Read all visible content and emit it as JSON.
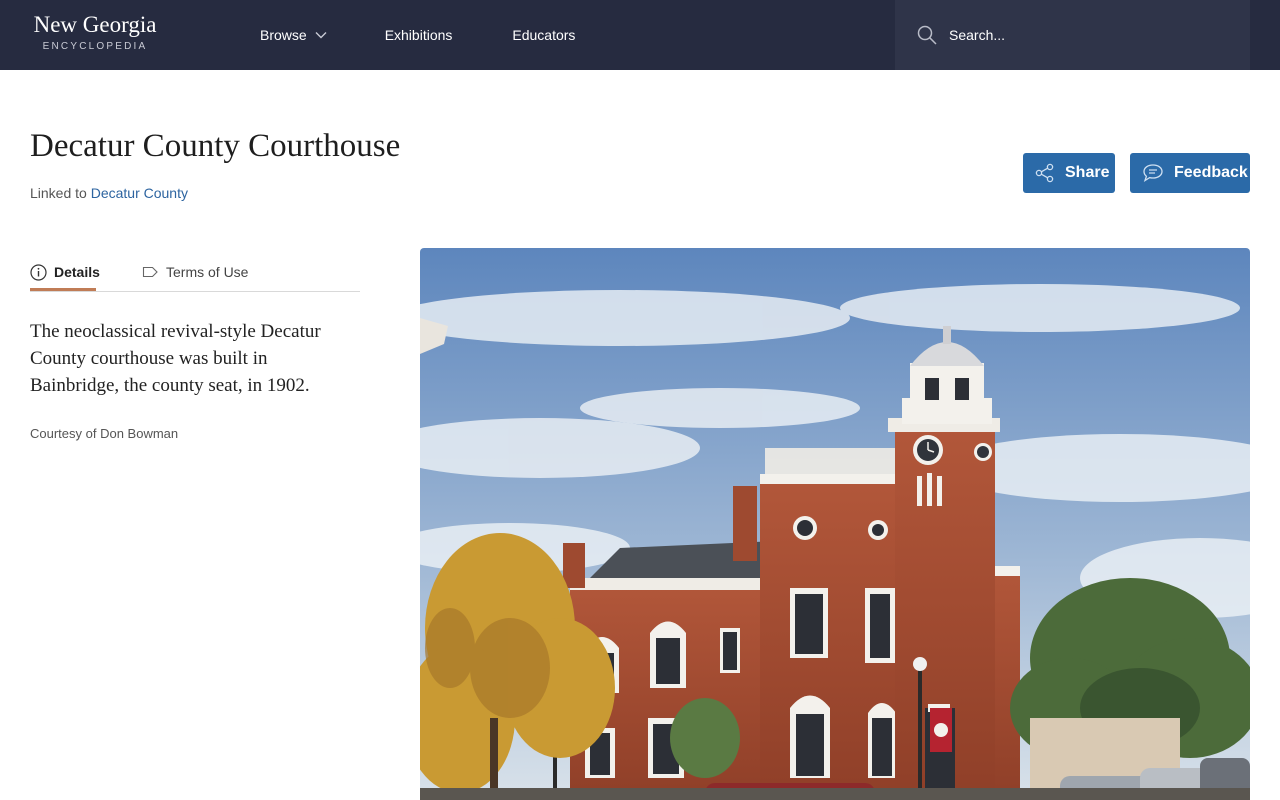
{
  "header": {
    "logo_main": "New Georgia",
    "logo_sub": "ENCYCLOPEDIA",
    "nav": {
      "browse": "Browse",
      "exhibitions": "Exhibitions",
      "educators": "Educators"
    },
    "search_placeholder": "Search..."
  },
  "page": {
    "title": "Decatur County Courthouse",
    "linked_prefix": "Linked to",
    "linked_link": "Decatur County",
    "share_label": "Share",
    "feedback_label": "Feedback"
  },
  "tabs": {
    "details": "Details",
    "terms": "Terms of Use"
  },
  "details": {
    "caption": "The neoclassical revival-style Decatur County courthouse was built in Bainbridge, the county seat, in 1902.",
    "credit": "Courtesy of Don Bowman"
  },
  "colors": {
    "header_bg": "#262b40",
    "accent_button": "#2b6aa8",
    "link": "#2d64a0",
    "tab_underline": "#c07c56"
  },
  "icons": {
    "browse_chevron": "chevron-down-icon",
    "search": "search-icon",
    "share": "share-icon",
    "feedback": "speech-bubble-icon",
    "details_tab": "info-icon",
    "terms_tab": "tag-icon"
  }
}
